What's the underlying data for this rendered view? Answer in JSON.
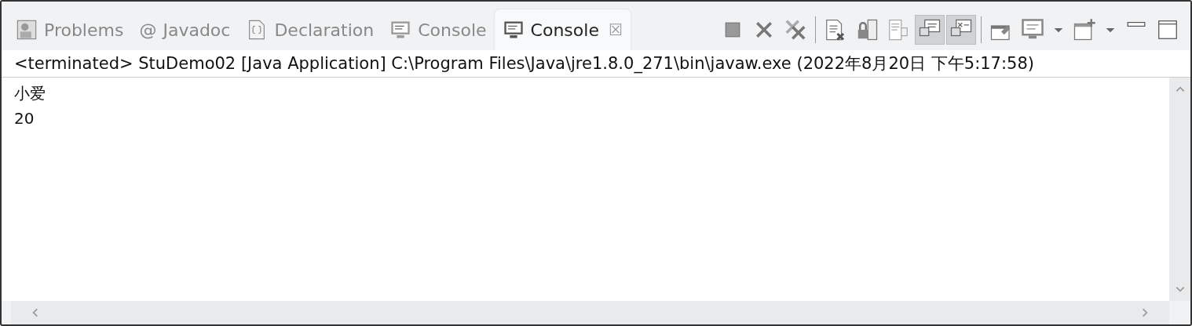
{
  "tabs": [
    {
      "label": "Problems",
      "kind": "problems",
      "selected": false
    },
    {
      "label": "Javadoc",
      "kind": "javadoc",
      "glyph": "@",
      "selected": false
    },
    {
      "label": "Declaration",
      "kind": "declaration",
      "selected": false
    },
    {
      "label": "Console",
      "kind": "console",
      "selected": false
    },
    {
      "label": "Console",
      "kind": "console",
      "selected": true,
      "close": "☒"
    }
  ],
  "toolbar_groups": [
    [
      {
        "kind": "stop",
        "pressed": false
      },
      {
        "kind": "remove",
        "pressed": false
      },
      {
        "kind": "remove-all",
        "pressed": false
      }
    ],
    [
      {
        "kind": "clear",
        "pressed": false
      },
      {
        "kind": "scroll-lock",
        "pressed": false
      },
      {
        "kind": "word-wrap",
        "pressed": false
      },
      {
        "kind": "stdout",
        "pressed": true
      },
      {
        "kind": "stderr",
        "pressed": true
      }
    ],
    [
      {
        "kind": "pin",
        "pressed": false
      },
      {
        "kind": "display",
        "pressed": false
      },
      {
        "kind": "dropdown",
        "pressed": false
      },
      {
        "kind": "new-console",
        "pressed": false
      },
      {
        "kind": "dropdown",
        "pressed": false
      },
      {
        "kind": "minimize",
        "pressed": false
      },
      {
        "kind": "maximize",
        "pressed": false
      }
    ]
  ],
  "header": "<terminated> StuDemo02 [Java Application] C:\\Program Files\\Java\\jre1.8.0_271\\bin\\javaw.exe (2022年8月20日 下午5:17:58)",
  "output": [
    "小爱",
    "20"
  ]
}
